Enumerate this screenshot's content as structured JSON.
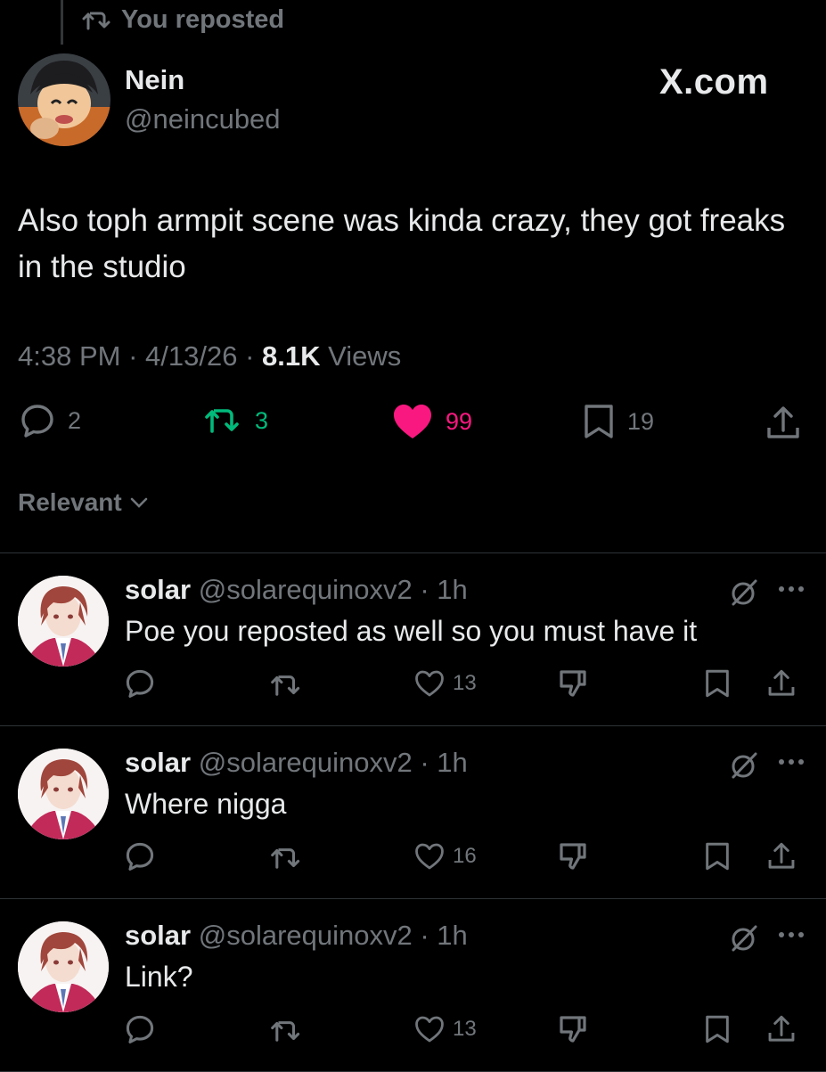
{
  "repost_banner": {
    "text": "You reposted"
  },
  "brand": "X.com",
  "post": {
    "author_name": "Nein",
    "author_handle": "@neincubed",
    "text": "Also toph armpit scene was kinda crazy, they got freaks in the studio",
    "time": "4:38 PM",
    "date": "4/13/26",
    "views_count": "8.1K",
    "views_label": "Views",
    "replies": "2",
    "reposts": "3",
    "likes": "99",
    "bookmarks": "19"
  },
  "sort": {
    "label": "Relevant"
  },
  "colors": {
    "repost_green": "#00ba7c",
    "like_pink": "#f91880",
    "muted": "#71767b",
    "text": "#e7e9ea",
    "divider": "#2f3336"
  },
  "replies": [
    {
      "name": "solar",
      "handle": "@solarequinoxv2",
      "time": "1h",
      "text": "Poe you reposted as well so you must have it",
      "likes": "13"
    },
    {
      "name": "solar",
      "handle": "@solarequinoxv2",
      "time": "1h",
      "text": "Where nigga",
      "likes": "16"
    },
    {
      "name": "solar",
      "handle": "@solarequinoxv2",
      "time": "1h",
      "text": "Link?",
      "likes": "13"
    }
  ]
}
